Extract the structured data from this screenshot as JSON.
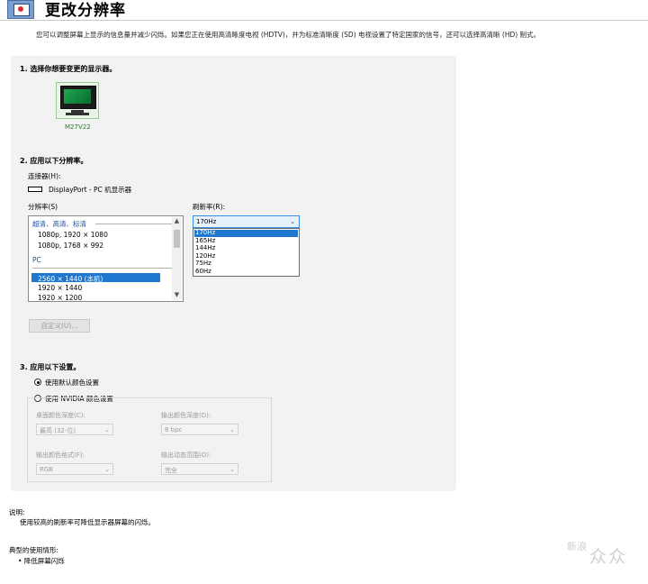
{
  "header": {
    "title": "更改分辨率"
  },
  "description": "您可以调整屏幕上显示的信息量并减少闪烁。如果您正在使用高清晰度电视 (HDTV)，并为标准清晰度 (SD) 电视设置了特定国家的信号，还可以选择高清晰 (HD) 制式。",
  "step1": {
    "title": "1.  选择你想要变更的显示器。",
    "monitor_label": "M27V22"
  },
  "step2": {
    "title": "2.  应用以下分辨率。",
    "connector_label": "连接器(H):",
    "connector_value": "DisplayPort - PC 机显示器",
    "resolution_label": "分辨率(S)",
    "resolution_groups": [
      {
        "name": "超清、高清、标清",
        "items": [
          "1080p, 1920 × 1080",
          "1080p, 1768 × 992"
        ]
      },
      {
        "name": "PC",
        "items": [
          "2560 × 1440 (本机)",
          "1920 × 1440",
          "1920 × 1200"
        ]
      }
    ],
    "selected_resolution": "2560 × 1440 (本机)",
    "refresh_label": "刷新率(R):",
    "refresh_value": "170Hz",
    "refresh_options": [
      "170Hz",
      "165Hz",
      "144Hz",
      "120Hz",
      "75Hz",
      "60Hz"
    ],
    "custom_button": "自定义(U)..."
  },
  "step3": {
    "title": "3.  应用以下设置。",
    "radio_default": "使用默认颜色设置",
    "radio_nvidia": "使用 NVIDIA 颜色设置",
    "desktop_depth_label": "桌面颜色深度(C):",
    "desktop_depth_value": "最高 (32-位)",
    "output_depth_label": "输出颜色深度(D):",
    "output_depth_value": "8 bpc",
    "output_format_label": "输出颜色格式(F):",
    "output_format_value": "RGB",
    "output_range_label": "输出动态范围(O):",
    "output_range_value": "完全"
  },
  "notes": {
    "desc_title": "说明:",
    "desc_text": "使用较高的刷新率可降低显示器屏幕的闪烁。",
    "usage_title": "典型的使用情形:",
    "usage_item": "• 降低屏幕闪烁"
  },
  "watermark": {
    "logo": "新浪",
    "name": "众众"
  }
}
